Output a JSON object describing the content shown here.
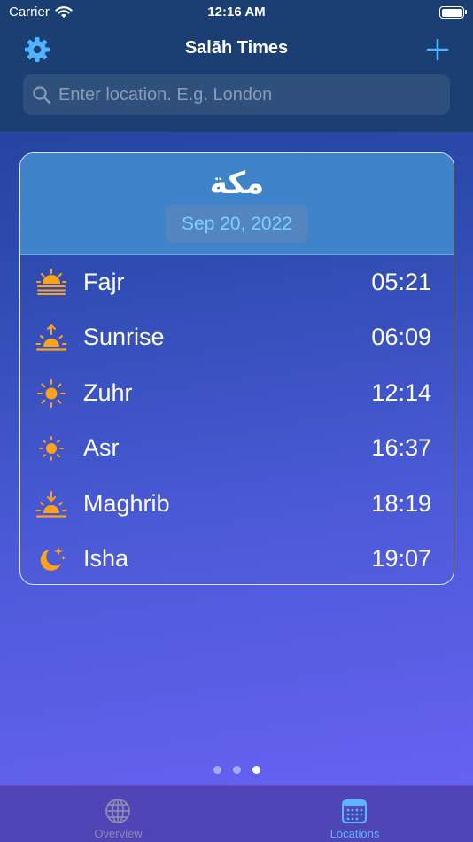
{
  "status_bar": {
    "carrier": "Carrier",
    "time": "12:16 AM"
  },
  "header": {
    "title": "Salāh Times",
    "search_placeholder": "Enter location. E.g. London"
  },
  "card": {
    "city": "مكة",
    "date": "Sep 20, 2022",
    "prayers": [
      {
        "name": "Fajr",
        "time": "05:21",
        "icon": "dawn-icon"
      },
      {
        "name": "Sunrise",
        "time": "06:09",
        "icon": "sunrise-icon"
      },
      {
        "name": "Zuhr",
        "time": "12:14",
        "icon": "sun-icon"
      },
      {
        "name": "Asr",
        "time": "16:37",
        "icon": "sun-small-icon"
      },
      {
        "name": "Maghrib",
        "time": "18:19",
        "icon": "sunset-icon"
      },
      {
        "name": "Isha",
        "time": "19:07",
        "icon": "moon-stars-icon"
      }
    ]
  },
  "pager": {
    "count": 3,
    "active_index": 2
  },
  "tabs": [
    {
      "label": "Overview",
      "icon": "globe-icon",
      "selected": false
    },
    {
      "label": "Locations",
      "icon": "calendar-icon",
      "selected": true
    }
  ],
  "colors": {
    "accent": "#4fb3ff",
    "icon_orange": "#ffa21a",
    "header_bg": "#1b3f73",
    "card_head_bg": "#3f83cb",
    "tab_selected": "#5ab8ff"
  }
}
